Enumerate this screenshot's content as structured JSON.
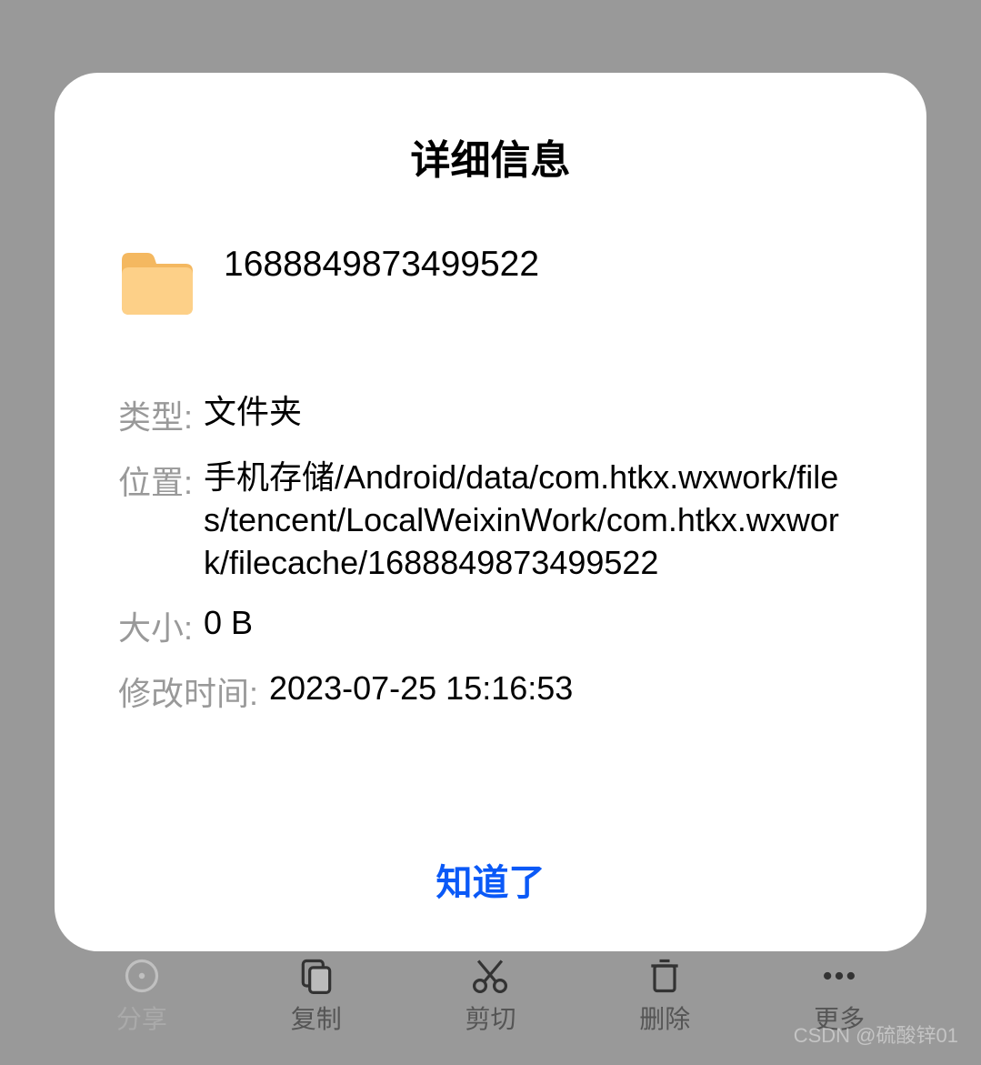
{
  "dialog": {
    "title": "详细信息",
    "folder_name": "1688849873499522",
    "confirm": "知道了"
  },
  "details": {
    "type_label": "类型:",
    "type_value": "文件夹",
    "location_label": "位置:",
    "location_value": "手机存储/Android/data/com.htkx.wxwork/files/tencent/LocalWeixinWork/com.htkx.wxwork/filecache/1688849873499522",
    "size_label": "大小:",
    "size_value": "0 B",
    "modified_label": "修改时间:",
    "modified_value": "2023-07-25 15:16:53"
  },
  "toolbar": {
    "share": "分享",
    "copy": "复制",
    "cut": "剪切",
    "delete": "删除",
    "more": "更多"
  },
  "watermark": "CSDN @硫酸锌01"
}
